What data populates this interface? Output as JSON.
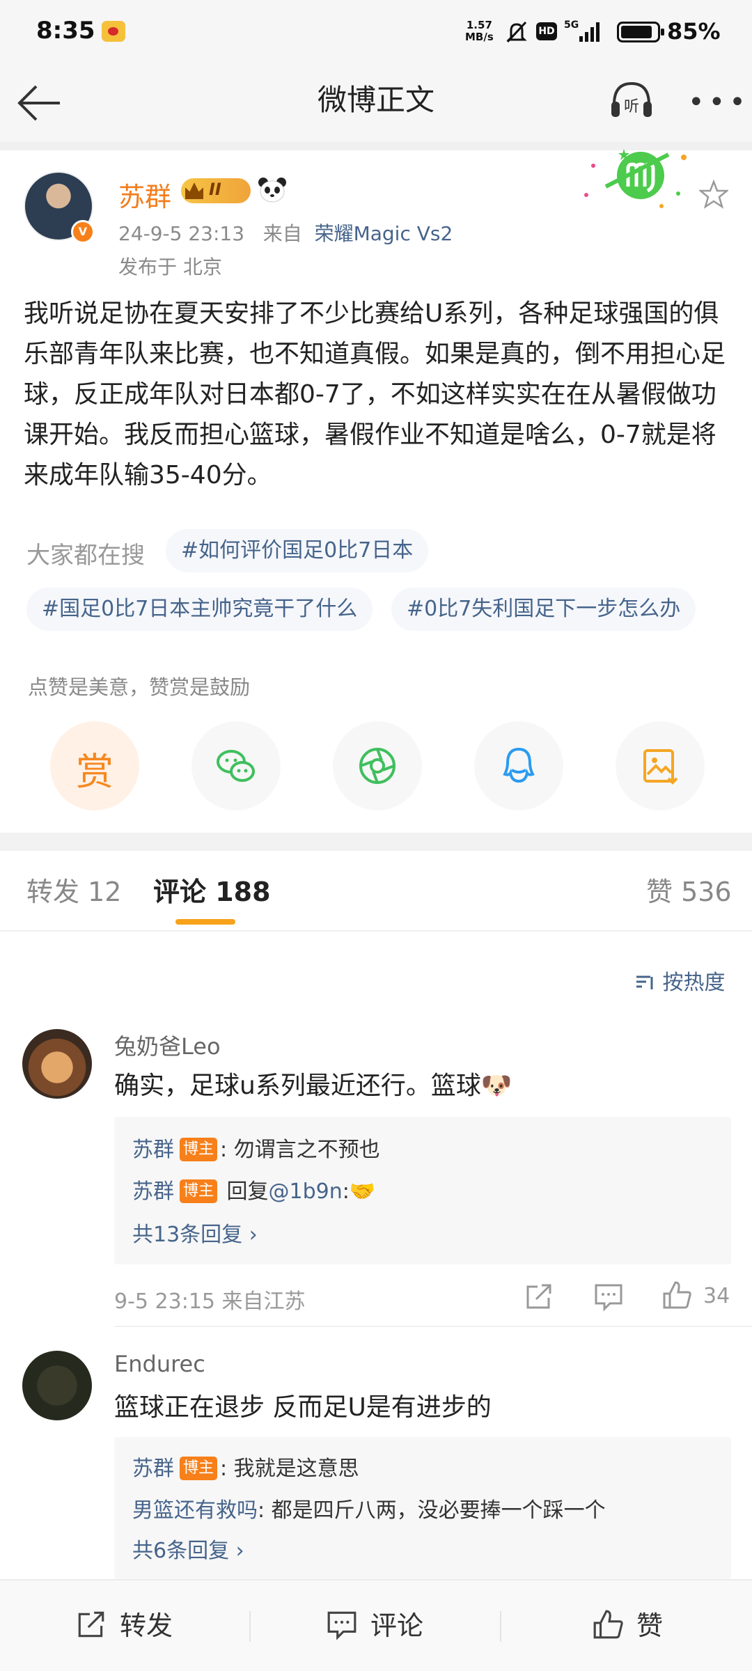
{
  "status_bar": {
    "time": "8:35",
    "net_speed_value": "1.57",
    "net_speed_unit": "MB/s",
    "hd_label": "HD",
    "network": "5G",
    "battery": "85%"
  },
  "nav": {
    "title": "微博正文",
    "listen_label": "听",
    "more_label": "•••"
  },
  "post": {
    "author": "苏群",
    "vip_level": "II",
    "verify_mark": "V",
    "date": "24-9-5 23:13",
    "source_prefix": "来自",
    "device": "荣耀Magic Vs2",
    "location": "发布于 北京",
    "body": "我听说足协在夏天安排了不少比赛给U系列，各种足球强国的俱乐部青年队来比赛，也不知道真假。如果是真的，倒不用担心足球，反正成年队对日本都0-7了，不如这样实实在在从暑假做功课开始。我反而担心篮球，暑假作业不知道是啥么，0-7就是将来成年队输35-40分。"
  },
  "search": {
    "label": "大家都在搜",
    "topics": [
      "#如何评价国足0比7日本",
      "#国足0比7日本主帅究竟干了什么",
      "#0比7失利国足下一步怎么办"
    ]
  },
  "share": {
    "hint": "点赞是美意，赞赏是鼓励",
    "reward_label": "赏"
  },
  "tabs": {
    "repost": "转发 12",
    "comments": "评论 188",
    "likes": "赞 536"
  },
  "sort_label": "按热度",
  "comments": [
    {
      "user": "兔奶爸Leo",
      "text": "确实，足球u系列最近还行。篮球🐶",
      "replies": [
        {
          "name": "苏群",
          "tag": "博主",
          "text": ": 勿谓言之不预也"
        },
        {
          "name": "苏群",
          "tag": "博主",
          "text": " 回复",
          "mention": "@1b9n",
          "suffix": ":🤝"
        }
      ],
      "more": "共13条回复",
      "meta": "9-5 23:15  来自江苏",
      "likes": "34"
    },
    {
      "user": "Endurec",
      "text": "篮球正在退步 反而足U是有进步的",
      "replies": [
        {
          "name": "苏群",
          "tag": "博主",
          "text": ": 我就是这意思"
        },
        {
          "name": "男篮还有救吗",
          "text": ": 都是四斤八两，没必要捧一个踩一个"
        }
      ],
      "more": "共6条回复"
    }
  ],
  "bottom_bar": {
    "repost": "转发",
    "comment": "评论",
    "like": "赞"
  },
  "colors": {
    "accent_orange": "#f37d1c",
    "link_blue": "#46648b",
    "tab_underline": "#f7a21b"
  }
}
